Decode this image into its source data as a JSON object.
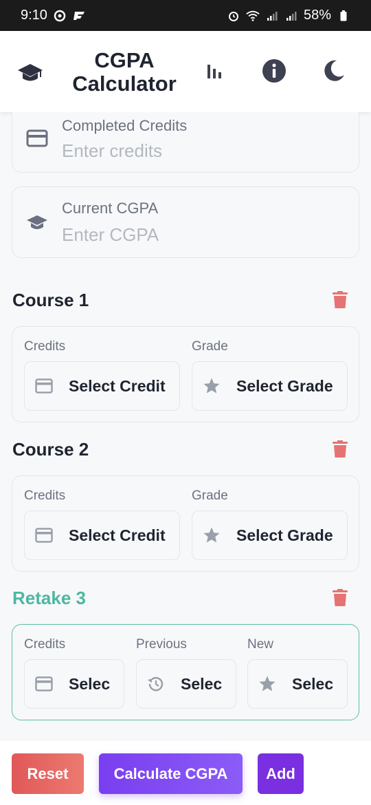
{
  "status_bar": {
    "time": "9:10",
    "battery": "58%"
  },
  "header": {
    "title": "CGPA Calculator",
    "icons": [
      "graduation-cap-icon",
      "bar-chart-icon",
      "info-icon",
      "moon-icon"
    ]
  },
  "inputs": {
    "completed_credits": {
      "label": "Completed Credits",
      "placeholder": "Enter credits"
    },
    "current_cgpa": {
      "label": "Current CGPA",
      "placeholder": "Enter CGPA"
    }
  },
  "courses": [
    {
      "title": "Course 1",
      "credits_label": "Credits",
      "grade_label": "Grade",
      "credit_value": "Select Credit",
      "grade_value": "Select Grade"
    },
    {
      "title": "Course 2",
      "credits_label": "Credits",
      "grade_label": "Grade",
      "credit_value": "Select Credit",
      "grade_value": "Select Grade"
    }
  ],
  "retake": {
    "title": "Retake 3",
    "credits_label": "Credits",
    "previous_label": "Previous",
    "new_label": "New",
    "credit_value": "Selec",
    "previous_value": "Selec",
    "new_value": "Selec"
  },
  "actions": {
    "reset": "Reset",
    "calculate": "Calculate CGPA",
    "add": "Add"
  },
  "colors": {
    "accent_purple": "#7a3ef0",
    "reset_red": "#e05858",
    "retake_teal": "#4fb6a0",
    "trash_red": "#e57373"
  }
}
